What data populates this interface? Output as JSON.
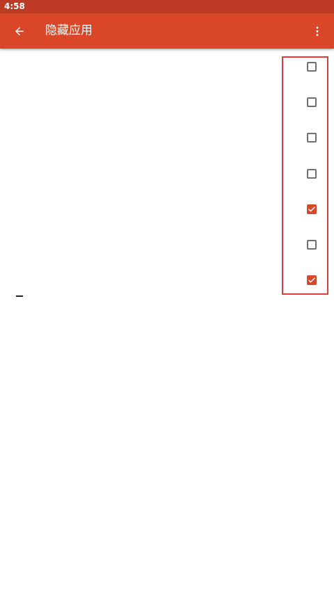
{
  "status_bar": {
    "time": "4:58"
  },
  "app_bar": {
    "title": "隐藏应用",
    "back_icon": "arrow-back-icon",
    "menu_icon": "more-vert-icon",
    "color": "#d94628",
    "status_color": "#bd3a24"
  },
  "app_list": {
    "items": [
      {
        "checked": false
      },
      {
        "checked": false
      },
      {
        "checked": false
      },
      {
        "checked": false
      },
      {
        "checked": true
      },
      {
        "checked": false
      },
      {
        "checked": true
      }
    ]
  },
  "colors": {
    "accent": "#d94628",
    "highlight": "#e53935",
    "unchecked_border": "#6f6f6f"
  }
}
